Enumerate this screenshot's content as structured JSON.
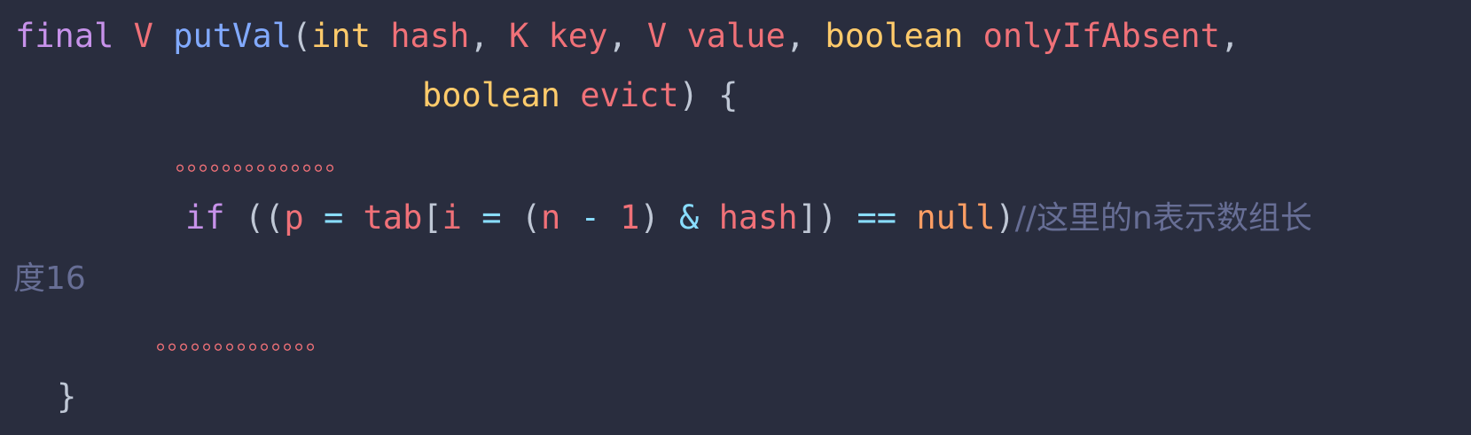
{
  "code": {
    "line1": {
      "kw_final": "final",
      "type_v": "V",
      "fn_name": "putVal",
      "p_open": "(",
      "type_int": "int",
      "p_hash": "hash",
      "comma1": ",",
      "type_k": "K",
      "p_key": "key",
      "comma2": ",",
      "type_v2": "V",
      "p_value": "value",
      "comma3": ",",
      "type_bool": "boolean",
      "p_only": "onlyIfAbsent",
      "comma4": ","
    },
    "line2": {
      "type_bool": "boolean",
      "p_evict": "evict",
      "p_close": ")",
      "brace": "{"
    },
    "dots1": "。。。。。。。。。。。。。。",
    "line4": {
      "kw_if": "if",
      "open": "((",
      "var_p": "p",
      "eq1": "=",
      "var_tab": "tab",
      "br_open": "[",
      "var_i": "i",
      "eq2": "=",
      "paren": "(",
      "var_n": "n",
      "minus": "-",
      "num_1": "1",
      "close1": ")",
      "amp": "&",
      "var_hash": "hash",
      "close2": "])",
      "eqeq": "==",
      "kw_null": "null",
      "close3": ")",
      "comment": "//这里的n表示数组长"
    },
    "line5": {
      "comment": "度16"
    },
    "dots2": "。。。。。。。。。。。。。。",
    "closing_brace": "}"
  }
}
